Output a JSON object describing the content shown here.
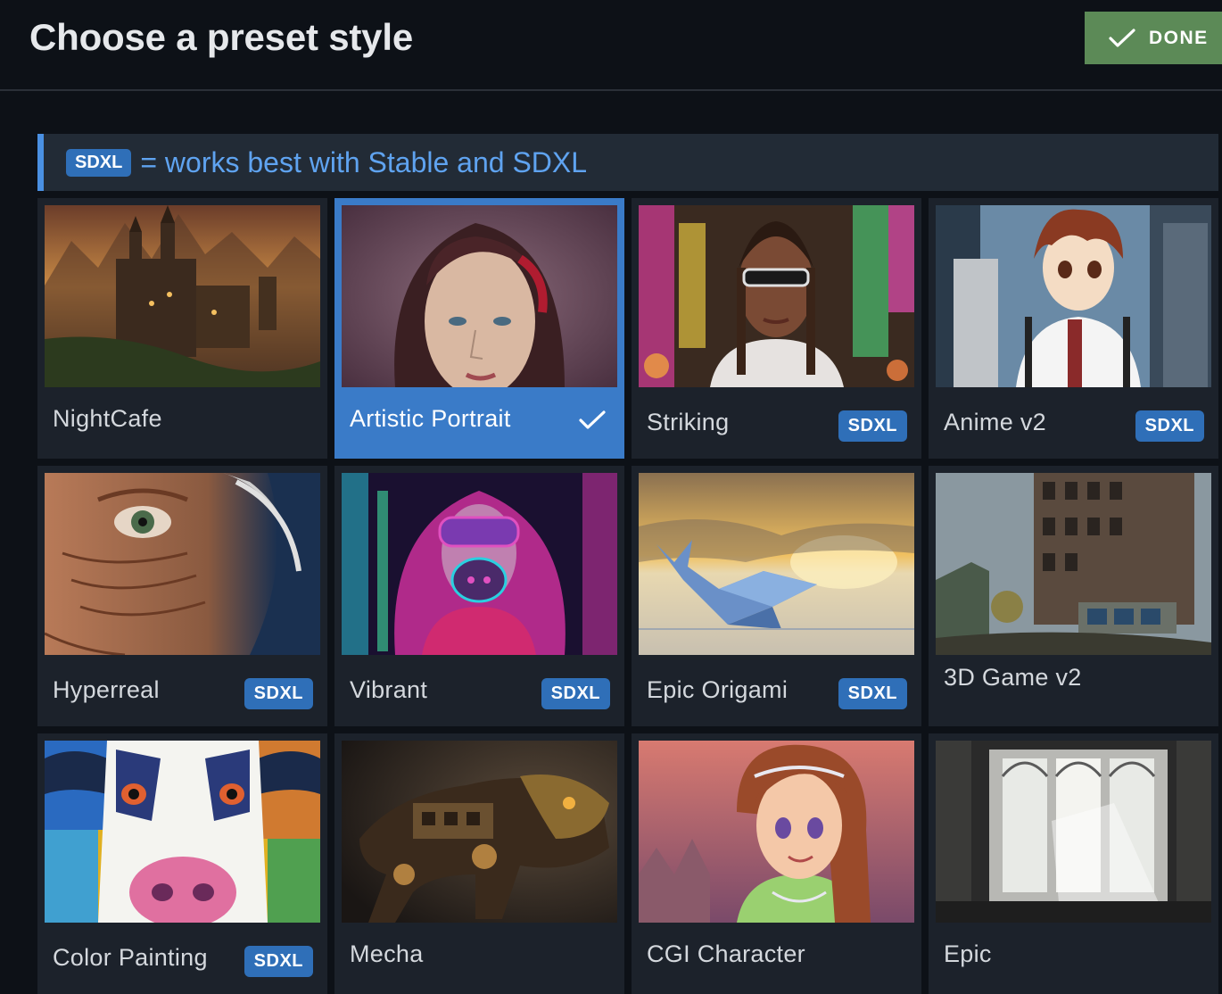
{
  "header": {
    "title": "Choose a preset style",
    "done_label": "DONE"
  },
  "info": {
    "badge": "SDXL",
    "text": "= works best with Stable and SDXL"
  },
  "presets": [
    {
      "label": "NightCafe",
      "sdxl": false,
      "selected": false,
      "image": "fantasy-castle"
    },
    {
      "label": "Artistic Portrait",
      "sdxl": false,
      "selected": true,
      "image": "woman-portrait"
    },
    {
      "label": "Striking",
      "sdxl": true,
      "selected": false,
      "image": "woman-sunglasses-city"
    },
    {
      "label": "Anime v2",
      "sdxl": true,
      "selected": false,
      "image": "anime-boy-city"
    },
    {
      "label": "Hyperreal",
      "sdxl": true,
      "selected": false,
      "image": "old-man-face"
    },
    {
      "label": "Vibrant",
      "sdxl": true,
      "selected": false,
      "image": "neon-masked-girl"
    },
    {
      "label": "Epic Origami",
      "sdxl": true,
      "selected": false,
      "image": "origami-whale"
    },
    {
      "label": "3D Game v2",
      "sdxl": false,
      "selected": false,
      "image": "ruined-building"
    },
    {
      "label": "Color Painting",
      "sdxl": true,
      "selected": false,
      "image": "colorful-cow"
    },
    {
      "label": "Mecha",
      "sdxl": false,
      "selected": false,
      "image": "mech-beast"
    },
    {
      "label": "CGI Character",
      "sdxl": false,
      "selected": false,
      "image": "cartoon-girl"
    },
    {
      "label": "Epic",
      "sdxl": false,
      "selected": false,
      "image": "cathedral-light"
    }
  ],
  "badge_label": "SDXL"
}
